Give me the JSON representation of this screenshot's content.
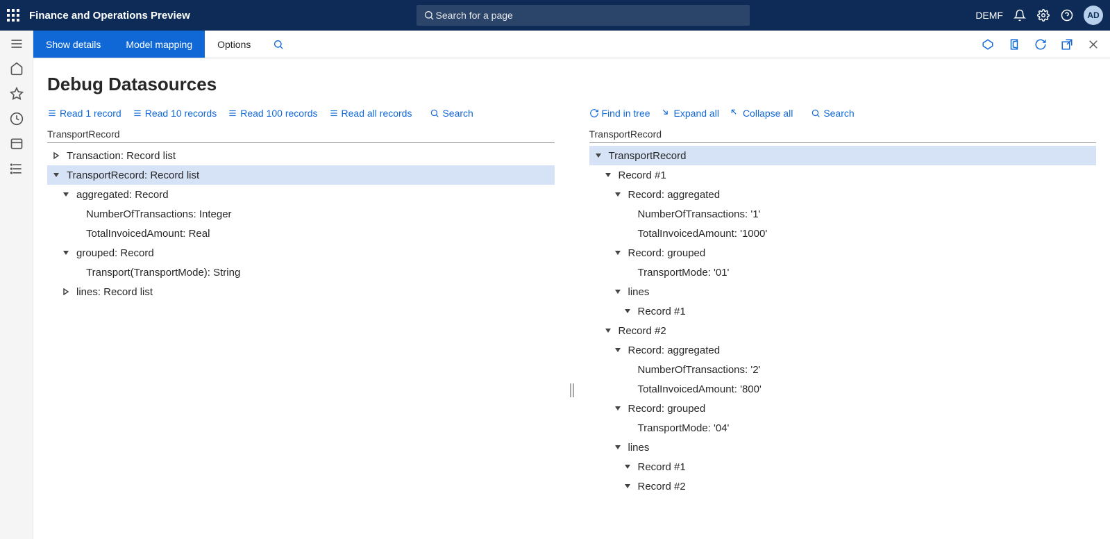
{
  "header": {
    "app_title": "Finance and Operations Preview",
    "search_placeholder": "Search for a page",
    "company": "DEMF",
    "avatar_initials": "AD"
  },
  "actionbar": {
    "show_details": "Show details",
    "model_mapping": "Model mapping",
    "options": "Options"
  },
  "page": {
    "title": "Debug Datasources"
  },
  "left_panel": {
    "toolbar": {
      "read1": "Read 1 record",
      "read10": "Read 10 records",
      "read100": "Read 100 records",
      "readall": "Read all records",
      "search": "Search"
    },
    "label": "TransportRecord",
    "rows": [
      {
        "indent": 0,
        "arrow": "right",
        "text": "Transaction: Record list",
        "selected": false
      },
      {
        "indent": 0,
        "arrow": "down",
        "text": "TransportRecord: Record list",
        "selected": true
      },
      {
        "indent": 1,
        "arrow": "down",
        "text": "aggregated: Record",
        "selected": false
      },
      {
        "indent": 2,
        "arrow": "none",
        "text": "NumberOfTransactions: Integer",
        "selected": false
      },
      {
        "indent": 2,
        "arrow": "none",
        "text": "TotalInvoicedAmount: Real",
        "selected": false
      },
      {
        "indent": 1,
        "arrow": "down",
        "text": "grouped: Record",
        "selected": false
      },
      {
        "indent": 2,
        "arrow": "none",
        "text": "Transport(TransportMode): String",
        "selected": false
      },
      {
        "indent": 1,
        "arrow": "right",
        "text": "lines: Record list",
        "selected": false
      }
    ]
  },
  "right_panel": {
    "toolbar": {
      "find_in_tree": "Find in tree",
      "expand_all": "Expand all",
      "collapse_all": "Collapse all",
      "search": "Search"
    },
    "label": "TransportRecord",
    "rows": [
      {
        "indent": 0,
        "arrow": "down",
        "text": "TransportRecord",
        "selected": true
      },
      {
        "indent": 1,
        "arrow": "down",
        "text": "Record #1",
        "selected": false
      },
      {
        "indent": 2,
        "arrow": "down",
        "text": "Record: aggregated",
        "selected": false
      },
      {
        "indent": 3,
        "arrow": "none",
        "text": "NumberOfTransactions: '1'",
        "selected": false
      },
      {
        "indent": 3,
        "arrow": "none",
        "text": "TotalInvoicedAmount: '1000'",
        "selected": false
      },
      {
        "indent": 2,
        "arrow": "down",
        "text": "Record: grouped",
        "selected": false
      },
      {
        "indent": 3,
        "arrow": "none",
        "text": "TransportMode: '01'",
        "selected": false
      },
      {
        "indent": 2,
        "arrow": "down",
        "text": "lines",
        "selected": false
      },
      {
        "indent": 3,
        "arrow": "down",
        "text": "Record #1",
        "selected": false
      },
      {
        "indent": 1,
        "arrow": "down",
        "text": "Record #2",
        "selected": false
      },
      {
        "indent": 2,
        "arrow": "down",
        "text": "Record: aggregated",
        "selected": false
      },
      {
        "indent": 3,
        "arrow": "none",
        "text": "NumberOfTransactions: '2'",
        "selected": false
      },
      {
        "indent": 3,
        "arrow": "none",
        "text": "TotalInvoicedAmount: '800'",
        "selected": false
      },
      {
        "indent": 2,
        "arrow": "down",
        "text": "Record: grouped",
        "selected": false
      },
      {
        "indent": 3,
        "arrow": "none",
        "text": "TransportMode: '04'",
        "selected": false
      },
      {
        "indent": 2,
        "arrow": "down",
        "text": "lines",
        "selected": false
      },
      {
        "indent": 3,
        "arrow": "down",
        "text": "Record #1",
        "selected": false
      },
      {
        "indent": 3,
        "arrow": "down",
        "text": "Record #2",
        "selected": false
      }
    ]
  }
}
